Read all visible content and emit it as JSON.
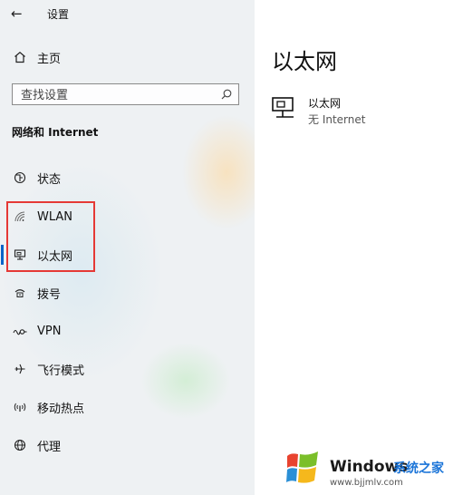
{
  "window": {
    "title": "设置"
  },
  "sidebar": {
    "home_label": "主页",
    "search_placeholder": "查找设置",
    "section_title": "网络和 Internet",
    "items": [
      {
        "label": "状态",
        "icon": "globe-status-icon",
        "selected": false
      },
      {
        "label": "WLAN",
        "icon": "wifi-icon",
        "selected": false
      },
      {
        "label": "以太网",
        "icon": "ethernet-icon",
        "selected": true
      },
      {
        "label": "拨号",
        "icon": "dial-up-icon",
        "selected": false
      },
      {
        "label": "VPN",
        "icon": "vpn-icon",
        "selected": false
      },
      {
        "label": "飞行模式",
        "icon": "airplane-icon",
        "selected": false
      },
      {
        "label": "移动热点",
        "icon": "hotspot-icon",
        "selected": false
      },
      {
        "label": "代理",
        "icon": "proxy-globe-icon",
        "selected": false
      }
    ]
  },
  "main": {
    "title": "以太网",
    "connection": {
      "name": "以太网",
      "status": "无 Internet"
    }
  },
  "watermark": {
    "brand": "Windows",
    "cn": "系统之家",
    "url": "www.bjjmlv.com"
  },
  "colors": {
    "accent": "#0a64c8",
    "annotation": "#e53935",
    "sidebar_bg": "#eef1f3"
  }
}
